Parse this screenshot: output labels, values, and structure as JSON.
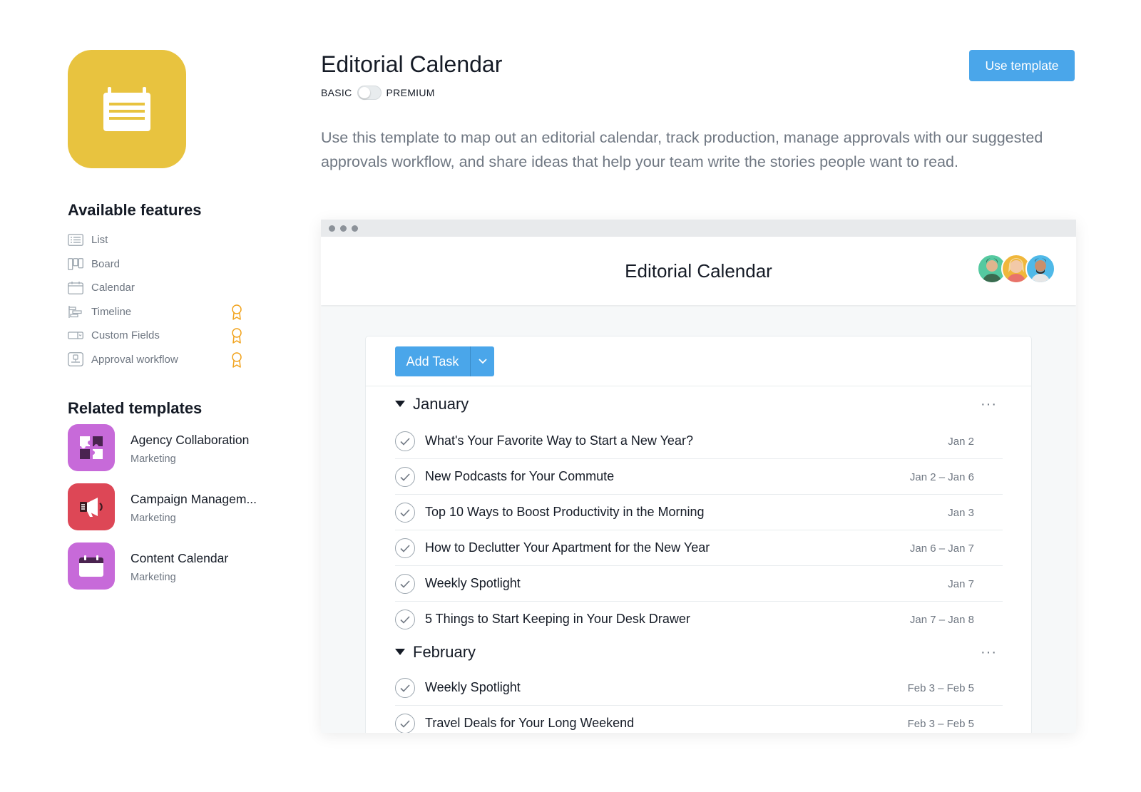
{
  "template": {
    "title": "Editorial Calendar",
    "plan_basic": "BASIC",
    "plan_premium": "PREMIUM",
    "premium_enabled": false,
    "use_template_label": "Use template",
    "description": "Use this template to map out an editorial calendar, track production, manage approvals with our suggested approvals workflow, and share ideas that help your team write the stories people want to read.",
    "icon": "notepad-icon",
    "icon_bg_color": "#e8c33f"
  },
  "features": {
    "heading": "Available features",
    "items": [
      {
        "label": "List",
        "icon": "list-icon",
        "premium": false
      },
      {
        "label": "Board",
        "icon": "board-icon",
        "premium": false
      },
      {
        "label": "Calendar",
        "icon": "calendar-icon",
        "premium": false
      },
      {
        "label": "Timeline",
        "icon": "timeline-icon",
        "premium": true
      },
      {
        "label": "Custom Fields",
        "icon": "custom-fields-icon",
        "premium": true
      },
      {
        "label": "Approval workflow",
        "icon": "approval-icon",
        "premium": true
      }
    ],
    "premium_badge_color": "#f1a21b"
  },
  "related": {
    "heading": "Related templates",
    "items": [
      {
        "name": "Agency Collaboration",
        "category": "Marketing",
        "icon": "puzzle-icon",
        "color": "#c76ad9"
      },
      {
        "name": "Campaign Managem...",
        "category": "Marketing",
        "icon": "megaphone-icon",
        "color": "#dd4756"
      },
      {
        "name": "Content Calendar",
        "category": "Marketing",
        "icon": "calendar-icon",
        "color": "#c76ad9"
      }
    ]
  },
  "preview": {
    "project_title": "Editorial Calendar",
    "avatars": [
      {
        "name": "avatar-1",
        "color": "#55c9a0"
      },
      {
        "name": "avatar-2",
        "color": "#f0b73b"
      },
      {
        "name": "avatar-3",
        "color": "#4fb9e8"
      }
    ],
    "add_task_label": "Add Task",
    "sections": [
      {
        "name": "January",
        "more": "···",
        "tasks": [
          {
            "name": "What's Your Favorite Way to Start a New Year?",
            "date": "Jan 2"
          },
          {
            "name": "New Podcasts for Your Commute",
            "date": "Jan 2 – Jan 6"
          },
          {
            "name": "Top 10 Ways to Boost Productivity in the Morning",
            "date": "Jan 3"
          },
          {
            "name": "How to Declutter Your Apartment for the New Year",
            "date": "Jan 6 – Jan 7"
          },
          {
            "name": "Weekly Spotlight",
            "date": "Jan 7"
          },
          {
            "name": "5 Things to Start Keeping in Your Desk Drawer",
            "date": "Jan 7 – Jan 8"
          }
        ]
      },
      {
        "name": "February",
        "more": "···",
        "tasks": [
          {
            "name": "Weekly Spotlight",
            "date": "Feb 3 – Feb 5"
          },
          {
            "name": "Travel Deals for Your Long Weekend",
            "date": "Feb 3 – Feb 5"
          }
        ]
      }
    ]
  },
  "colors": {
    "accent": "#4aa6ea",
    "text_primary": "#151b26",
    "text_secondary": "#6f7782"
  }
}
